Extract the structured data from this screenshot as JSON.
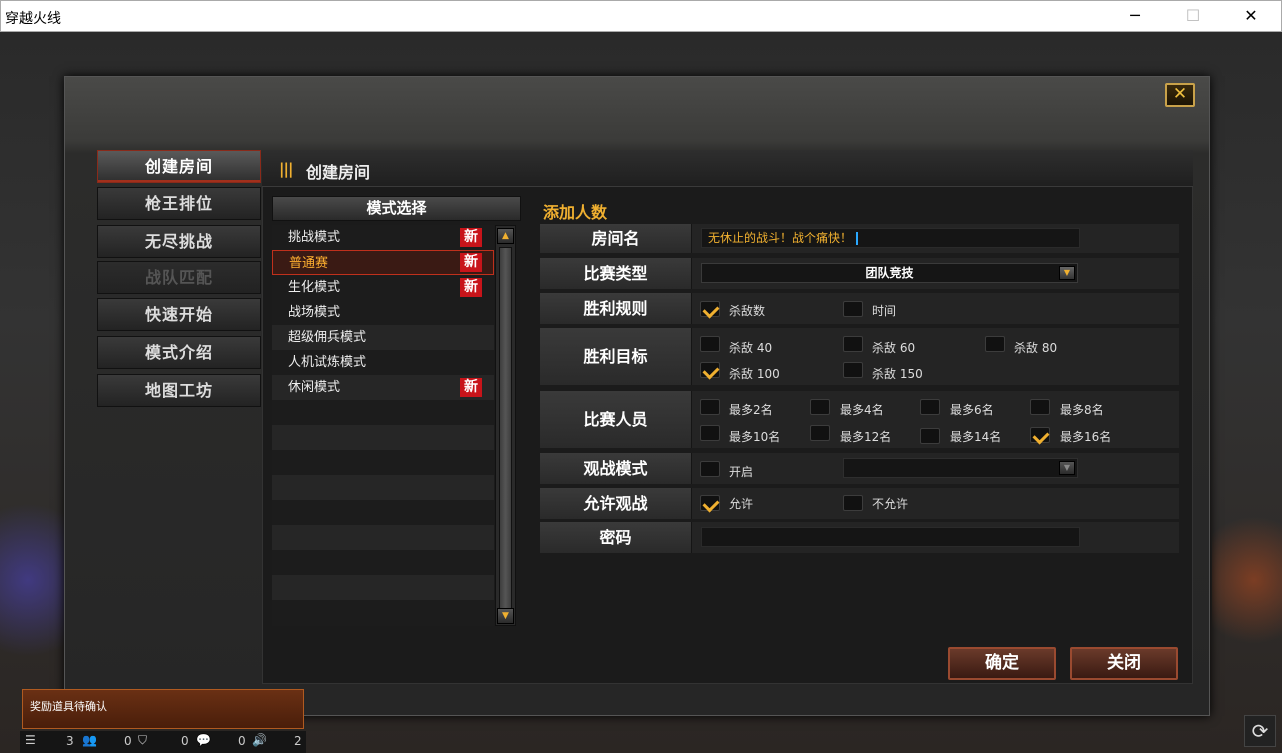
{
  "window": {
    "title": "穿越火线",
    "minimize": "─",
    "maximize": "☐",
    "close": "✕"
  },
  "dialog": {
    "close_label": "✕"
  },
  "sidebar": {
    "items": [
      {
        "label": "创建房间"
      },
      {
        "label": "枪王排位"
      },
      {
        "label": "无尽挑战"
      },
      {
        "label": "战队匹配"
      },
      {
        "label": "快速开始"
      },
      {
        "label": "模式介绍"
      },
      {
        "label": "地图工坊"
      }
    ]
  },
  "header": {
    "icon": "|||",
    "title": "创建房间"
  },
  "modes": {
    "title": "模式选择",
    "items": [
      {
        "label": "挑战模式",
        "badge": "新"
      },
      {
        "label": "普通赛",
        "badge": "新"
      },
      {
        "label": "生化模式",
        "badge": "新"
      },
      {
        "label": "战场模式",
        "badge": ""
      },
      {
        "label": "超级佣兵模式",
        "badge": ""
      },
      {
        "label": "人机试炼模式",
        "badge": ""
      },
      {
        "label": "休闲模式",
        "badge": "新"
      }
    ]
  },
  "form": {
    "section_title": "添加人数",
    "room_name": {
      "label": "房间名",
      "value": "无休止的战斗！战个痛快！"
    },
    "match_type": {
      "label": "比赛类型",
      "value": "团队竞技"
    },
    "win_rule": {
      "label": "胜利规则",
      "options": [
        {
          "label": "杀敌数",
          "checked": true
        },
        {
          "label": "时间",
          "checked": false
        }
      ]
    },
    "win_target": {
      "label": "胜利目标",
      "options": [
        {
          "label": "杀敌 40",
          "checked": false
        },
        {
          "label": "杀敌 60",
          "checked": false
        },
        {
          "label": "杀敌 80",
          "checked": false
        },
        {
          "label": "杀敌 100",
          "checked": true
        },
        {
          "label": "杀敌 150",
          "checked": false
        }
      ]
    },
    "players": {
      "label": "比赛人员",
      "options": [
        {
          "label": "最多2名",
          "checked": false
        },
        {
          "label": "最多4名",
          "checked": false
        },
        {
          "label": "最多6名",
          "checked": false
        },
        {
          "label": "最多8名",
          "checked": false
        },
        {
          "label": "最多10名",
          "checked": false
        },
        {
          "label": "最多12名",
          "checked": false
        },
        {
          "label": "最多14名",
          "checked": false
        },
        {
          "label": "最多16名",
          "checked": true
        }
      ]
    },
    "spectate_mode": {
      "label": "观战模式",
      "option": {
        "label": "开启",
        "checked": false
      }
    },
    "allow_spectate": {
      "label": "允许观战",
      "options": [
        {
          "label": "允许",
          "checked": true
        },
        {
          "label": "不允许",
          "checked": false
        }
      ]
    },
    "password": {
      "label": "密码",
      "value": ""
    }
  },
  "actions": {
    "confirm": "确定",
    "close": "关闭"
  },
  "notice": {
    "text": "奖励道具待确认"
  },
  "statusbar": {
    "count1": "3",
    "count2": "0",
    "count3": "0",
    "count4": "0",
    "count5": "2"
  },
  "colors": {
    "accent": "#f0b030",
    "danger": "#c8141a",
    "selected_border": "#c0301c"
  }
}
